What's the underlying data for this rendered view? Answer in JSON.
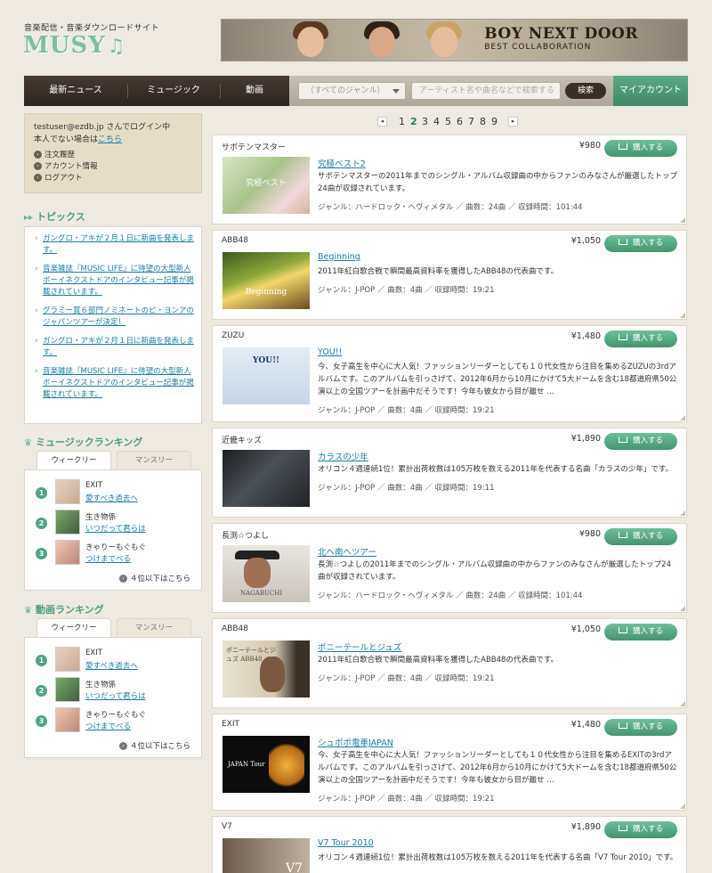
{
  "header": {
    "subtitle": "音楽配信・音楽ダウンロードサイト",
    "logo": "MUSY",
    "logo_note": "♫",
    "banner_title": "BOY NEXT DOOR",
    "banner_subtitle": "BEST COLLABORATION"
  },
  "nav": {
    "items": [
      "最新ニュース",
      "ミュージック",
      "動画"
    ],
    "genre_select": "（すべてのジャンル）",
    "search_placeholder": "アーティスト名や曲名などで検索する",
    "search_button": "検索",
    "my_account": "マイアカウント"
  },
  "login": {
    "line1": "testuser@ezdb.jp さんでログイン中",
    "line2_prefix": "本人でない場合は",
    "line2_link": "こちら",
    "links": [
      "注文履歴",
      "アカウント情報",
      "ログアウト"
    ]
  },
  "topics": {
    "heading": "トピックス",
    "items": [
      "ガングロ・アキが２月１日に新曲を発表します。",
      "音楽雑誌『MUSIC LIFE』に待望の大型新人ボーイネクストドアのインタビュー記事が掲載されています。",
      "グラミー賞６部門ノミネートのピ・ヨンアのジャパンツアーが決定！",
      "ガングロ・アキが２月１日に新曲を発表します。",
      "音楽雑誌『MUSIC LIFE』に待望の大型新人ボーイネクストドアのインタビュー記事が掲載されています。"
    ]
  },
  "music_ranking": {
    "heading": "ミュージックランキング",
    "tab_weekly": "ウィークリー",
    "tab_monthly": "マンスリー",
    "items": [
      {
        "num": "1",
        "artist": "EXIT",
        "title": "愛すべき過去へ"
      },
      {
        "num": "2",
        "artist": "生き物係",
        "title": "いつだって君らは"
      },
      {
        "num": "3",
        "artist": "きゃりーもぐもぐ",
        "title": "つけまでべる"
      }
    ],
    "more": "４位以下はこちら"
  },
  "video_ranking": {
    "heading": "動画ランキング",
    "tab_weekly": "ウィークリー",
    "tab_monthly": "マンスリー",
    "items": [
      {
        "num": "1",
        "artist": "EXIT",
        "title": "愛すべき過去へ"
      },
      {
        "num": "2",
        "artist": "生き物係",
        "title": "いつだって君らは"
      },
      {
        "num": "3",
        "artist": "きゃりーもぐもぐ",
        "title": "つけまでべる"
      }
    ],
    "more": "４位以下はこちら"
  },
  "pager": {
    "prev": "◂",
    "next": "▸",
    "pages": [
      "1",
      "2",
      "3",
      "4",
      "5",
      "6",
      "7",
      "8",
      "9"
    ],
    "current": "2"
  },
  "buy_label": "購入する",
  "products": [
    {
      "artist": "サボテンマスター",
      "price": "¥980",
      "title": "究極ベスト2",
      "desc": "サボテンマスターの2011年までのシングル・アルバム収録曲の中からファンのみなさんが厳選したトップ24曲が収録されています。",
      "meta": "ジャンル：ハードロック・ヘヴィメタル ／ 曲数：24曲 ／ 収録時間：101:44",
      "thumb_caption": "究極ベスト"
    },
    {
      "artist": "ABB48",
      "price": "¥1,050",
      "title": "Beginning",
      "desc": "2011年紅白歌合戦で瞬間最高資料率を獲得したABB48の代表曲です。",
      "meta": "ジャンル：J-POP ／ 曲数：4曲 ／ 収録時間：19:21",
      "thumb_caption": "Beginning"
    },
    {
      "artist": "ZUZU",
      "price": "¥1,480",
      "title": "YOU!!",
      "desc": "今、女子高生を中心に大人気！ファッションリーダーとしても１０代女性から注目を集めるZUZUの3rdアルバムです。このアルバムを引っさげて、2012年6月から10月にかけて5大ドームを含む18都道府県50公演以上の全国ツアーを計画中だそうです！今年も彼女から目が離せ …",
      "meta": "ジャンル：J-POP ／ 曲数：4曲 ／ 収録時間：19:21",
      "thumb_caption": "YOU!!"
    },
    {
      "artist": "近畿キッズ",
      "price": "¥1,890",
      "title": "カラスの少年",
      "desc": "オリコン４週連続1位！累計出荷枚数は105万枚を数える2011年を代表する名曲「カラスの少年」です。",
      "meta": "ジャンル：J-POP ／ 曲数：4曲 ／ 収録時間：19:11",
      "thumb_caption": ""
    },
    {
      "artist": "長渕☆つよし",
      "price": "¥980",
      "title": "北へ南へツアー",
      "desc": "長渕☆つよしの2011年までのシングル・アルバム収録曲の中からファンのみなさんが厳選したトップ24曲が収録されています。",
      "meta": "ジャンル：ハードロック・ヘヴィメタル ／ 曲数：24曲 ／ 収録時間：101:44",
      "thumb_caption": "NAGABUCHI"
    },
    {
      "artist": "ABB48",
      "price": "¥1,050",
      "title": "ポニーテールとジュズ",
      "desc": "2011年紅白歌合戦で瞬間最高資料率を獲得したABB48の代表曲です。",
      "meta": "ジャンル：J-POP ／ 曲数：4曲 ／ 収録時間：19:21",
      "thumb_caption": "ポニーテールとジュズ ABB48"
    },
    {
      "artist": "EXIT",
      "price": "¥1,480",
      "title": "シュポポ電車JAPAN",
      "desc": "今、女子高生を中心に大人気！ファッションリーダーとしても１０代女性から注目を集めるEXITの3rdアルバムです。このアルバムを引っさげて、2012年6月から10月にかけて5大ドームを含む18都道府県50公演以上の全国ツアーを計画中だそうです！今年も彼女から目が離せ …",
      "meta": "ジャンル：J-POP ／ 曲数：4曲 ／ 収録時間：19:21",
      "thumb_caption": "JAPAN Tour"
    },
    {
      "artist": "V7",
      "price": "¥1,890",
      "title": "V7 Tour 2010",
      "desc": "オリコン４週連続1位！累計出荷枚数は105万枚を数える2011年を代表する名曲「V7 Tour 2010」です。",
      "meta": "",
      "thumb_caption": "V7"
    }
  ]
}
